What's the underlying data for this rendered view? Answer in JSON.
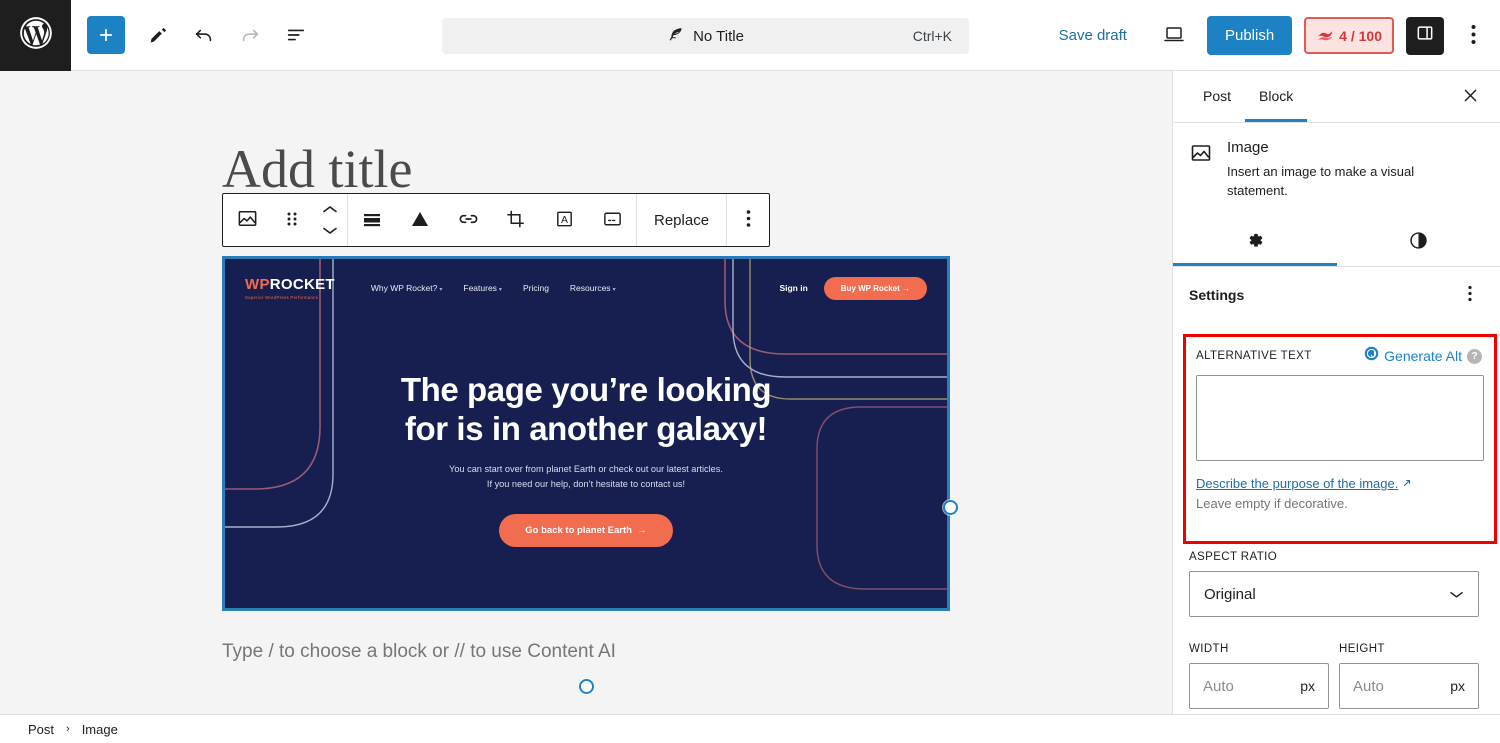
{
  "header": {
    "logo_icon": "wordpress-logo-icon",
    "add_block_icon": "plus-icon",
    "edit_tool_icon": "pencil-icon",
    "undo_icon": "undo-arrow-icon",
    "redo_icon": "redo-arrow-icon",
    "list_view_icon": "document-outline-icon",
    "command_bar": {
      "icon": "feather-quill-icon",
      "title": "No Title",
      "shortcut": "Ctrl+K"
    },
    "save_draft_label": "Save draft",
    "preview_icon": "laptop-preview-icon",
    "publish_label": "Publish",
    "seo_score": {
      "icon": "rank-math-icon",
      "value": "4 / 100",
      "border_color": "#e05a52",
      "background_color": "#fbe3e1",
      "text_color": "#d63638"
    },
    "settings_toggle_icon": "sidebar-panel-icon",
    "options_icon": "kebab-vertical-icon",
    "accent_color": "#1d82c4"
  },
  "canvas": {
    "post_title_placeholder": "Add title",
    "paragraph_placeholder": "Type / to choose a block or // to use Content AI",
    "block_toolbar": {
      "block_type_icon": "image-block-icon",
      "drag_handle_icon": "drag-dots-icon",
      "move_up_icon": "chevron-up-icon",
      "move_down_icon": "chevron-down-icon",
      "align_icon": "align-options-icon",
      "duotone_icon": "duotone-filter-icon",
      "link_icon": "link-icon",
      "crop_icon": "crop-icon",
      "text_over_image_icon": "text-over-image-icon",
      "caption_icon": "add-caption-icon",
      "replace_label": "Replace",
      "more_options_icon": "kebab-vertical-icon"
    },
    "selection": {
      "border_color": "#2b7cb9",
      "handle_right_icon": "resize-handle-right",
      "handle_bottom_icon": "resize-handle-bottom"
    }
  },
  "image_content": {
    "background_color": "#161f4f",
    "accent_color": "#f26c4f",
    "logo": {
      "wp": "WP",
      "rocket": "ROCKET",
      "tagline": "Superior WordPress Performance"
    },
    "nav_links": [
      {
        "label": "Why WP Rocket?",
        "has_dropdown": true
      },
      {
        "label": "Features",
        "has_dropdown": true
      },
      {
        "label": "Pricing",
        "has_dropdown": false
      },
      {
        "label": "Resources",
        "has_dropdown": true
      }
    ],
    "sign_in_label": "Sign in",
    "buy_label": "Buy WP Rocket",
    "buy_arrow": "→",
    "headline_line1": "The page you’re looking",
    "headline_line2": "for is in another galaxy!",
    "subtext_line1": "You can start over from planet Earth or check out our latest articles.",
    "subtext_line2": "If you need our help, don’t hesitate to contact us!",
    "cta_label": "Go back to planet Earth",
    "cta_arrow": "→",
    "deco_line_colors": [
      "#b2647a",
      "#c9d4ee",
      "#b8a87a"
    ]
  },
  "sidebar": {
    "tabs": [
      {
        "label": "Post",
        "active": false
      },
      {
        "label": "Block",
        "active": true
      }
    ],
    "close_icon": "close-x-icon",
    "block": {
      "icon": "image-block-icon",
      "title": "Image",
      "description": "Insert an image to make a visual statement."
    },
    "icon_tabs": [
      {
        "icon": "gear-settings-icon",
        "active": true
      },
      {
        "icon": "styles-contrast-icon",
        "active": false
      }
    ],
    "settings_title": "Settings",
    "settings_more_icon": "kebab-vertical-icon",
    "alternative_text": {
      "label": "ALTERNATIVE TEXT",
      "generate_icon": "generate-alt-ai-icon",
      "generate_label": "Generate Alt",
      "help_icon": "question-mark-icon",
      "value": "",
      "placeholder": "",
      "describe_link": "Describe the purpose of the image.",
      "external_link_icon": "external-link-icon",
      "note": "Leave empty if decorative.",
      "highlight_color": "#f00000"
    },
    "aspect_ratio": {
      "label": "ASPECT RATIO",
      "value": "Original",
      "chevron_icon": "chevron-down-icon"
    },
    "width": {
      "label": "WIDTH",
      "placeholder": "Auto",
      "unit": "px"
    },
    "height": {
      "label": "HEIGHT",
      "placeholder": "Auto",
      "unit": "px"
    }
  },
  "footer": {
    "breadcrumb": [
      {
        "label": "Post"
      },
      {
        "label": "Image"
      }
    ],
    "separator_icon": "chevron-right-icon",
    "separator": "›"
  }
}
